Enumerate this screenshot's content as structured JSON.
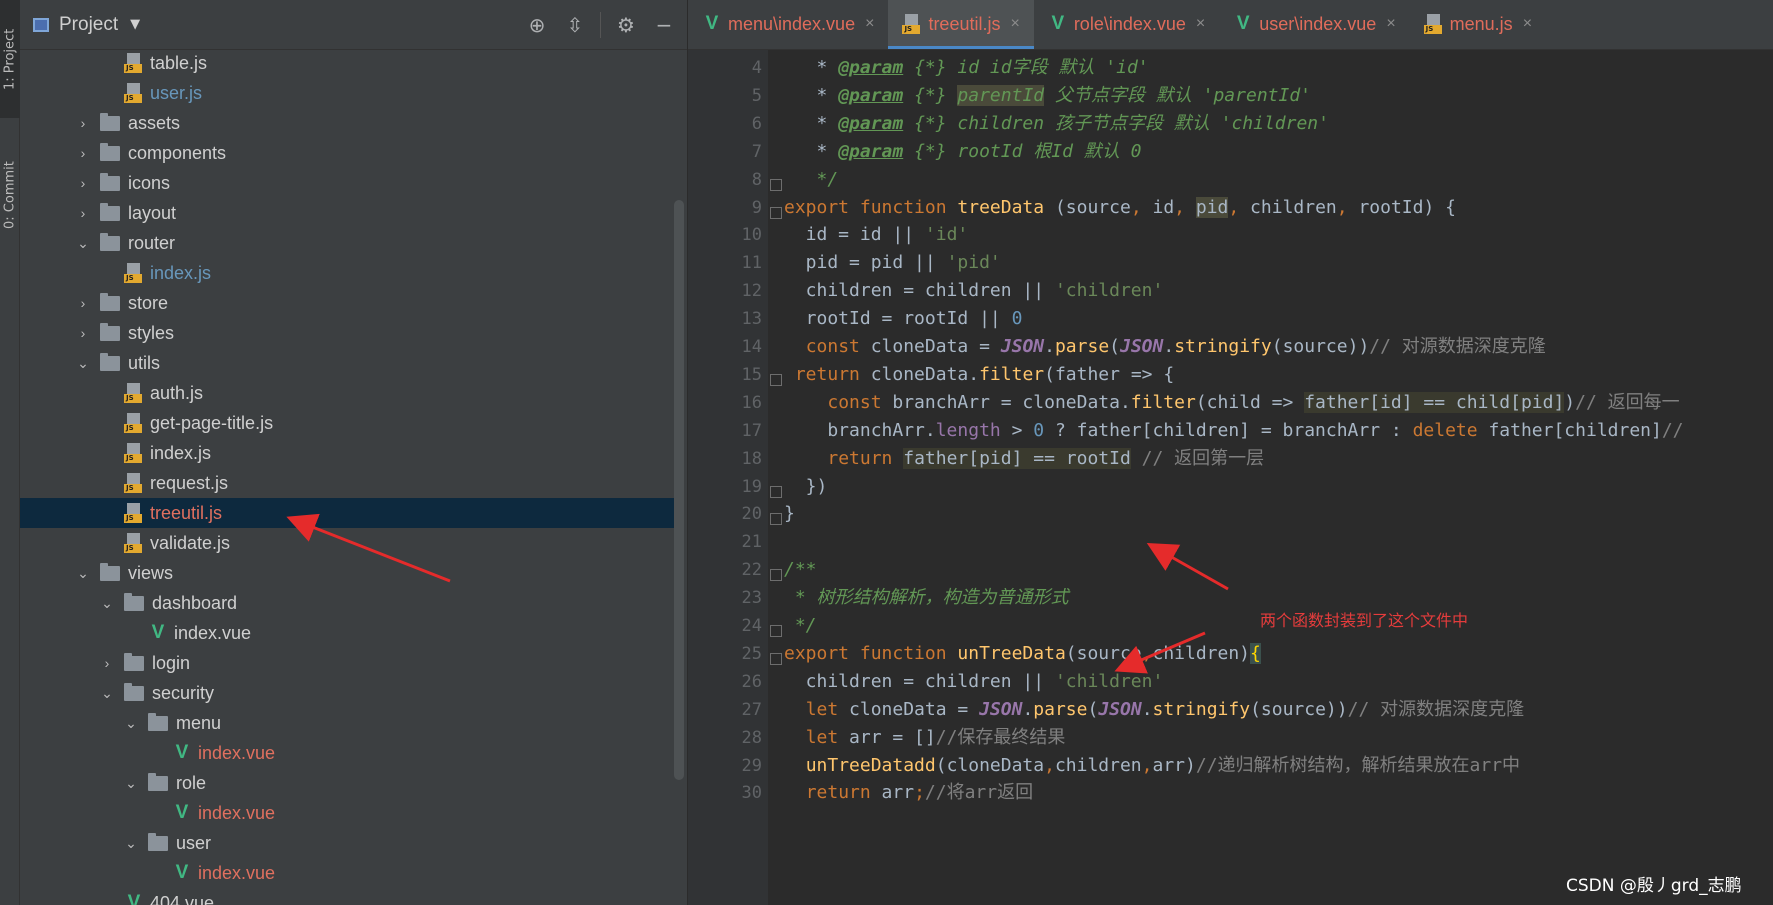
{
  "tool_strip": {
    "project_tab": "1: Project",
    "commit_tab": "0: Commit"
  },
  "project_panel": {
    "title": "Project",
    "icons": [
      "locate-icon",
      "collapse-icon",
      "gear-icon",
      "minimize-icon"
    ],
    "tree": [
      {
        "name": "table.js",
        "type": "js",
        "style": "norm"
      },
      {
        "name": "user.js",
        "type": "js",
        "style": "blue"
      },
      {
        "name": "assets",
        "type": "folder",
        "expanded": false
      },
      {
        "name": "components",
        "type": "folder",
        "expanded": false
      },
      {
        "name": "icons",
        "type": "folder",
        "expanded": false
      },
      {
        "name": "layout",
        "type": "folder",
        "expanded": false
      },
      {
        "name": "router",
        "type": "folder",
        "expanded": true
      },
      {
        "name": "index.js",
        "type": "js",
        "style": "blue"
      },
      {
        "name": "store",
        "type": "folder",
        "expanded": false
      },
      {
        "name": "styles",
        "type": "folder",
        "expanded": false
      },
      {
        "name": "utils",
        "type": "folder",
        "expanded": true
      },
      {
        "name": "auth.js",
        "type": "js",
        "style": "norm"
      },
      {
        "name": "get-page-title.js",
        "type": "js",
        "style": "norm"
      },
      {
        "name": "index.js",
        "type": "js",
        "style": "norm"
      },
      {
        "name": "request.js",
        "type": "js",
        "style": "norm"
      },
      {
        "name": "treeutil.js",
        "type": "js",
        "style": "red",
        "selected": true
      },
      {
        "name": "validate.js",
        "type": "js",
        "style": "norm"
      },
      {
        "name": "views",
        "type": "folder",
        "expanded": true
      },
      {
        "name": "dashboard",
        "type": "folder",
        "expanded": true
      },
      {
        "name": "index.vue",
        "type": "vue",
        "style": "norm"
      },
      {
        "name": "login",
        "type": "folder",
        "expanded": false
      },
      {
        "name": "security",
        "type": "folder",
        "expanded": true
      },
      {
        "name": "menu",
        "type": "folder",
        "expanded": true
      },
      {
        "name": "index.vue",
        "type": "vue",
        "style": "red"
      },
      {
        "name": "role",
        "type": "folder",
        "expanded": true
      },
      {
        "name": "index.vue",
        "type": "vue",
        "style": "red"
      },
      {
        "name": "user",
        "type": "folder",
        "expanded": true
      },
      {
        "name": "index.vue",
        "type": "vue",
        "style": "red"
      },
      {
        "name": "404.vue",
        "type": "vue",
        "style": "norm"
      }
    ]
  },
  "editor": {
    "tabs": [
      {
        "label": "menu\\index.vue",
        "kind": "vue",
        "active": false
      },
      {
        "label": "treeutil.js",
        "kind": "js",
        "active": true
      },
      {
        "label": "role\\index.vue",
        "kind": "vue",
        "active": false
      },
      {
        "label": "user\\index.vue",
        "kind": "vue",
        "active": false
      },
      {
        "label": "menu.js",
        "kind": "js",
        "active": false
      }
    ],
    "close_glyph": "×",
    "line_numbers": [
      "4",
      "5",
      "6",
      "7",
      "8",
      "9",
      "10",
      "11",
      "12",
      "13",
      "14",
      "15",
      "16",
      "17",
      "18",
      "19",
      "20",
      "21",
      "22",
      "23",
      "24",
      "25",
      "26",
      "27",
      "28",
      "29",
      "30"
    ],
    "code_lines": [
      "   * <span class=\"doctag\">@param</span> <span class=\"doc\">{*} id id字段 默认 'id'</span>",
      "   * <span class=\"doctag\">@param</span> <span class=\"doc\">{*} </span><span class=\"doc hl2\">parentId</span><span class=\"doc\"> 父节点字段 默认 'parentId'</span>",
      "   * <span class=\"doctag\">@param</span> <span class=\"doc\">{*} children 孩子节点字段 默认 'children'</span>",
      "   * <span class=\"doctag\">@param</span> <span class=\"doc\">{*} rootId 根Id 默认 0</span>",
      "   <span class=\"doc\">*/</span>",
      "<span class=\"kw\">export function</span> <span class=\"fn\">treeData</span> (source<span class=\"kw\">,</span> id<span class=\"kw\">,</span> <span class=\"hl2\">pid</span><span class=\"kw\">,</span> children<span class=\"kw\">,</span> rootId) {",
      "  id = id || <span class=\"str\">'id'</span>",
      "  pid = pid || <span class=\"str\">'pid'</span>",
      "  children = children || <span class=\"str\">'children'</span>",
      "  rootId = rootId || <span class=\"num\">0</span>",
      "  <span class=\"kw\">const</span> cloneData = <span class=\"json\">JSON</span>.<span class=\"fn\">parse</span>(<span class=\"json\">JSON</span>.<span class=\"fn\">stringify</span>(source))<span class=\"cmt\">// 对源数据深度克隆</span>",
      " <span class=\"kw\">return</span> cloneData.<span class=\"fn\">filter</span>(father => {",
      "    <span class=\"kw\">const</span> branchArr = cloneData.<span class=\"fn\">filter</span>(child => <span class=\"hl\">father[id] == child[pid]</span>)<span class=\"cmt\">// 返回每一</span>",
      "    branchArr.<span class=\"prop\">length</span> > <span class=\"num\">0</span> ? father[children] = branchArr : <span class=\"kw\">delete</span> father[children]<span class=\"cmt\">//</span>",
      "    <span class=\"kw\">return</span> <span class=\"hl\">father[pid] == rootId</span> <span class=\"cmt\">// 返回第一层</span>",
      "  })",
      "}",
      "",
      "<span class=\"doc\">/**</span>",
      " <span class=\"doc\">* 树形结构解析，构造为普通形式</span>",
      " <span class=\"doc\">*/</span>",
      "<span class=\"kw\">export function</span> <span class=\"fn\">unTreeData</span>(source<span class=\"kw\">,</span>children)<span class=\"brace hl3\">{</span>",
      "  children = children || <span class=\"str\">'children'</span>",
      "  <span class=\"kw\">let</span> cloneData = <span class=\"json\">JSON</span>.<span class=\"fn\">parse</span>(<span class=\"json\">JSON</span>.<span class=\"fn\">stringify</span>(source))<span class=\"cmt\">// 对源数据深度克隆</span>",
      "  <span class=\"kw\">let</span> arr = []<span class=\"cmt\">//保存最终结果</span>",
      "  <span class=\"fn\">unTreeDatadd</span>(cloneData<span class=\"kw\">,</span>children<span class=\"kw\">,</span>arr)<span class=\"cmt\">//递归解析树结构，解析结果放在arr中</span>",
      "  <span class=\"kw\">return</span> arr<span class=\"kw\">;</span><span class=\"cmt\">//将arr返回</span>"
    ]
  },
  "annotation": "两个函数封装到了这个文件中",
  "watermark": "CSDN @殷丿grd_志鹏"
}
